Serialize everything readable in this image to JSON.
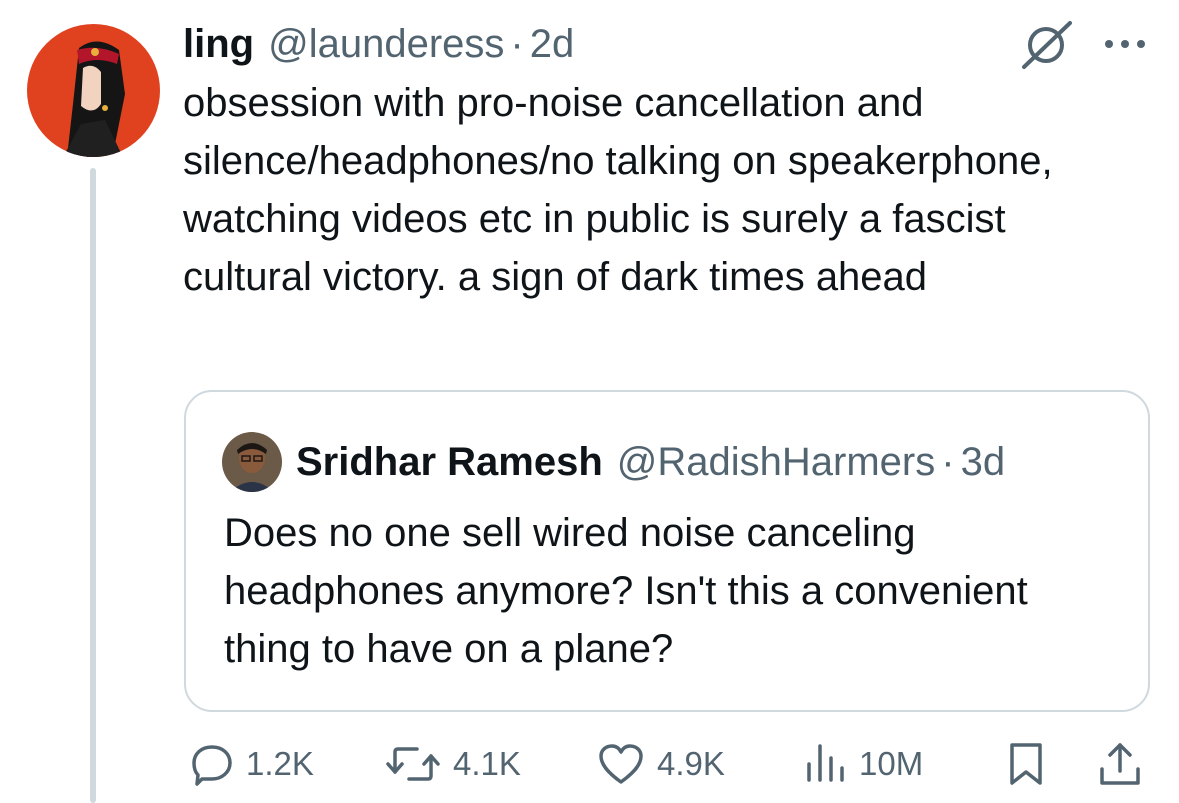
{
  "tweet": {
    "author": {
      "name": "ling",
      "handle": "@launderess",
      "time": "2d"
    },
    "separator": "·",
    "text": "obsession with pro-noise cancellation and silence/headphones/no talking on speakerphone, watching videos etc in public is surely a fascist cultural victory. a sign of dark times ahead",
    "icons": {
      "grok": "grok-icon",
      "more": "more-icon"
    }
  },
  "quote": {
    "author": {
      "name": "Sridhar Ramesh",
      "handle": "@RadishHarmers",
      "time": "3d"
    },
    "separator": "·",
    "text": "Does no one sell wired noise canceling headphones anymore? Isn't this a convenient thing to have on a plane?"
  },
  "actions": {
    "replies": "1.2K",
    "reposts": "4.1K",
    "likes": "4.9K",
    "views": "10M"
  },
  "colors": {
    "text_primary": "#0f1419",
    "text_secondary": "#536471",
    "border": "#cfd9de",
    "avatar_bg": "#e0421f"
  }
}
